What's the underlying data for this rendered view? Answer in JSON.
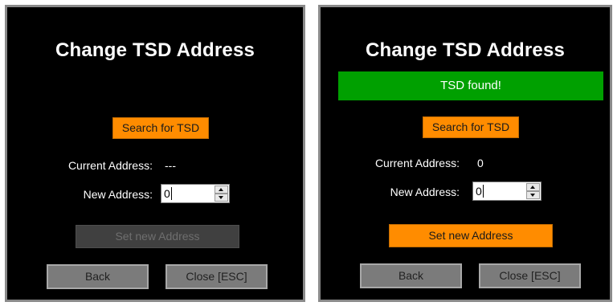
{
  "left_dialog": {
    "title": "Change TSD Address",
    "search_button": "Search for TSD",
    "current_address_label": "Current Address:",
    "current_address_value": "---",
    "new_address_label": "New Address:",
    "new_address_value": "0",
    "set_button": "Set new Address",
    "set_button_enabled": false,
    "back_button": "Back",
    "close_button": "Close [ESC]"
  },
  "right_dialog": {
    "title": "Change TSD Address",
    "status_message": "TSD found!",
    "search_button": "Search for TSD",
    "current_address_label": "Current Address:",
    "current_address_value": "0",
    "new_address_label": "New Address:",
    "new_address_value": "0",
    "set_button": "Set new Address",
    "set_button_enabled": true,
    "back_button": "Back",
    "close_button": "Close [ESC]"
  },
  "colors": {
    "background": "#000000",
    "accent_orange": "#ff8c00",
    "status_green": "#00a000",
    "button_gray": "#7b7b7b",
    "disabled_gray": "#404040"
  },
  "icons": {
    "spin_up": "chevron-up-icon",
    "spin_down": "chevron-down-icon"
  }
}
